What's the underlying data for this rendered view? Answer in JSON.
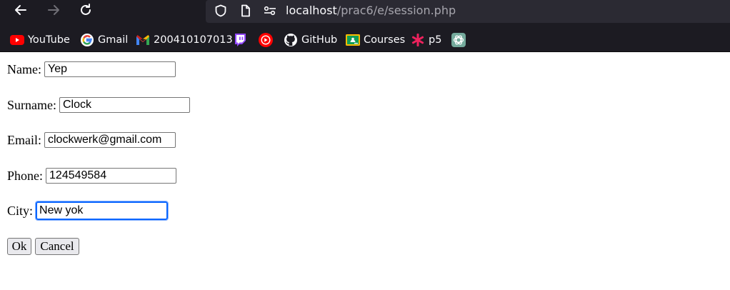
{
  "browser": {
    "url_host": "localhost",
    "url_path": "/prac6/e/session.php",
    "bookmarks": [
      {
        "label": "YouTube",
        "icon": "youtube-icon"
      },
      {
        "label": "Gmail",
        "icon": "google-icon"
      },
      {
        "label": "200410107013",
        "icon": "gmail-icon"
      },
      {
        "label": "",
        "icon": "twitch-icon"
      },
      {
        "label": "",
        "icon": "youtube-music-icon"
      },
      {
        "label": "GitHub",
        "icon": "github-icon"
      },
      {
        "label": "Courses",
        "icon": "google-classroom-icon"
      },
      {
        "label": "p5",
        "icon": "p5-icon"
      },
      {
        "label": "",
        "icon": "chatgpt-icon"
      }
    ]
  },
  "form": {
    "name": {
      "label": "Name:",
      "value": "Yep"
    },
    "surname": {
      "label": "Surname:",
      "value": "Clock"
    },
    "email": {
      "label": "Email:",
      "value": "clockwerk@gmail.com"
    },
    "phone": {
      "label": "Phone:",
      "value": "124549584"
    },
    "city": {
      "label": "City:",
      "value": "New yok"
    },
    "ok_label": "Ok",
    "cancel_label": "Cancel"
  },
  "colors": {
    "toolbar_bg": "#1c1b22",
    "urlbar_bg": "#2b2a33",
    "focus_ring": "#0a66ff",
    "button_bg": "#e9e9ed"
  }
}
